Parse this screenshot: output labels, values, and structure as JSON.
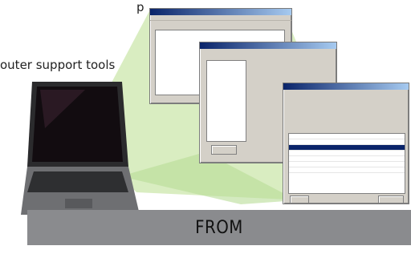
{
  "caption": {
    "top": "p",
    "left": "outer support tools"
  },
  "footer": {
    "label": "FROM"
  },
  "icons": [
    "laptop-icon"
  ],
  "colors": {
    "beam": "#c8e6a8",
    "footer_bar": "#8a8b8e",
    "titlebar": "#0a246a"
  }
}
